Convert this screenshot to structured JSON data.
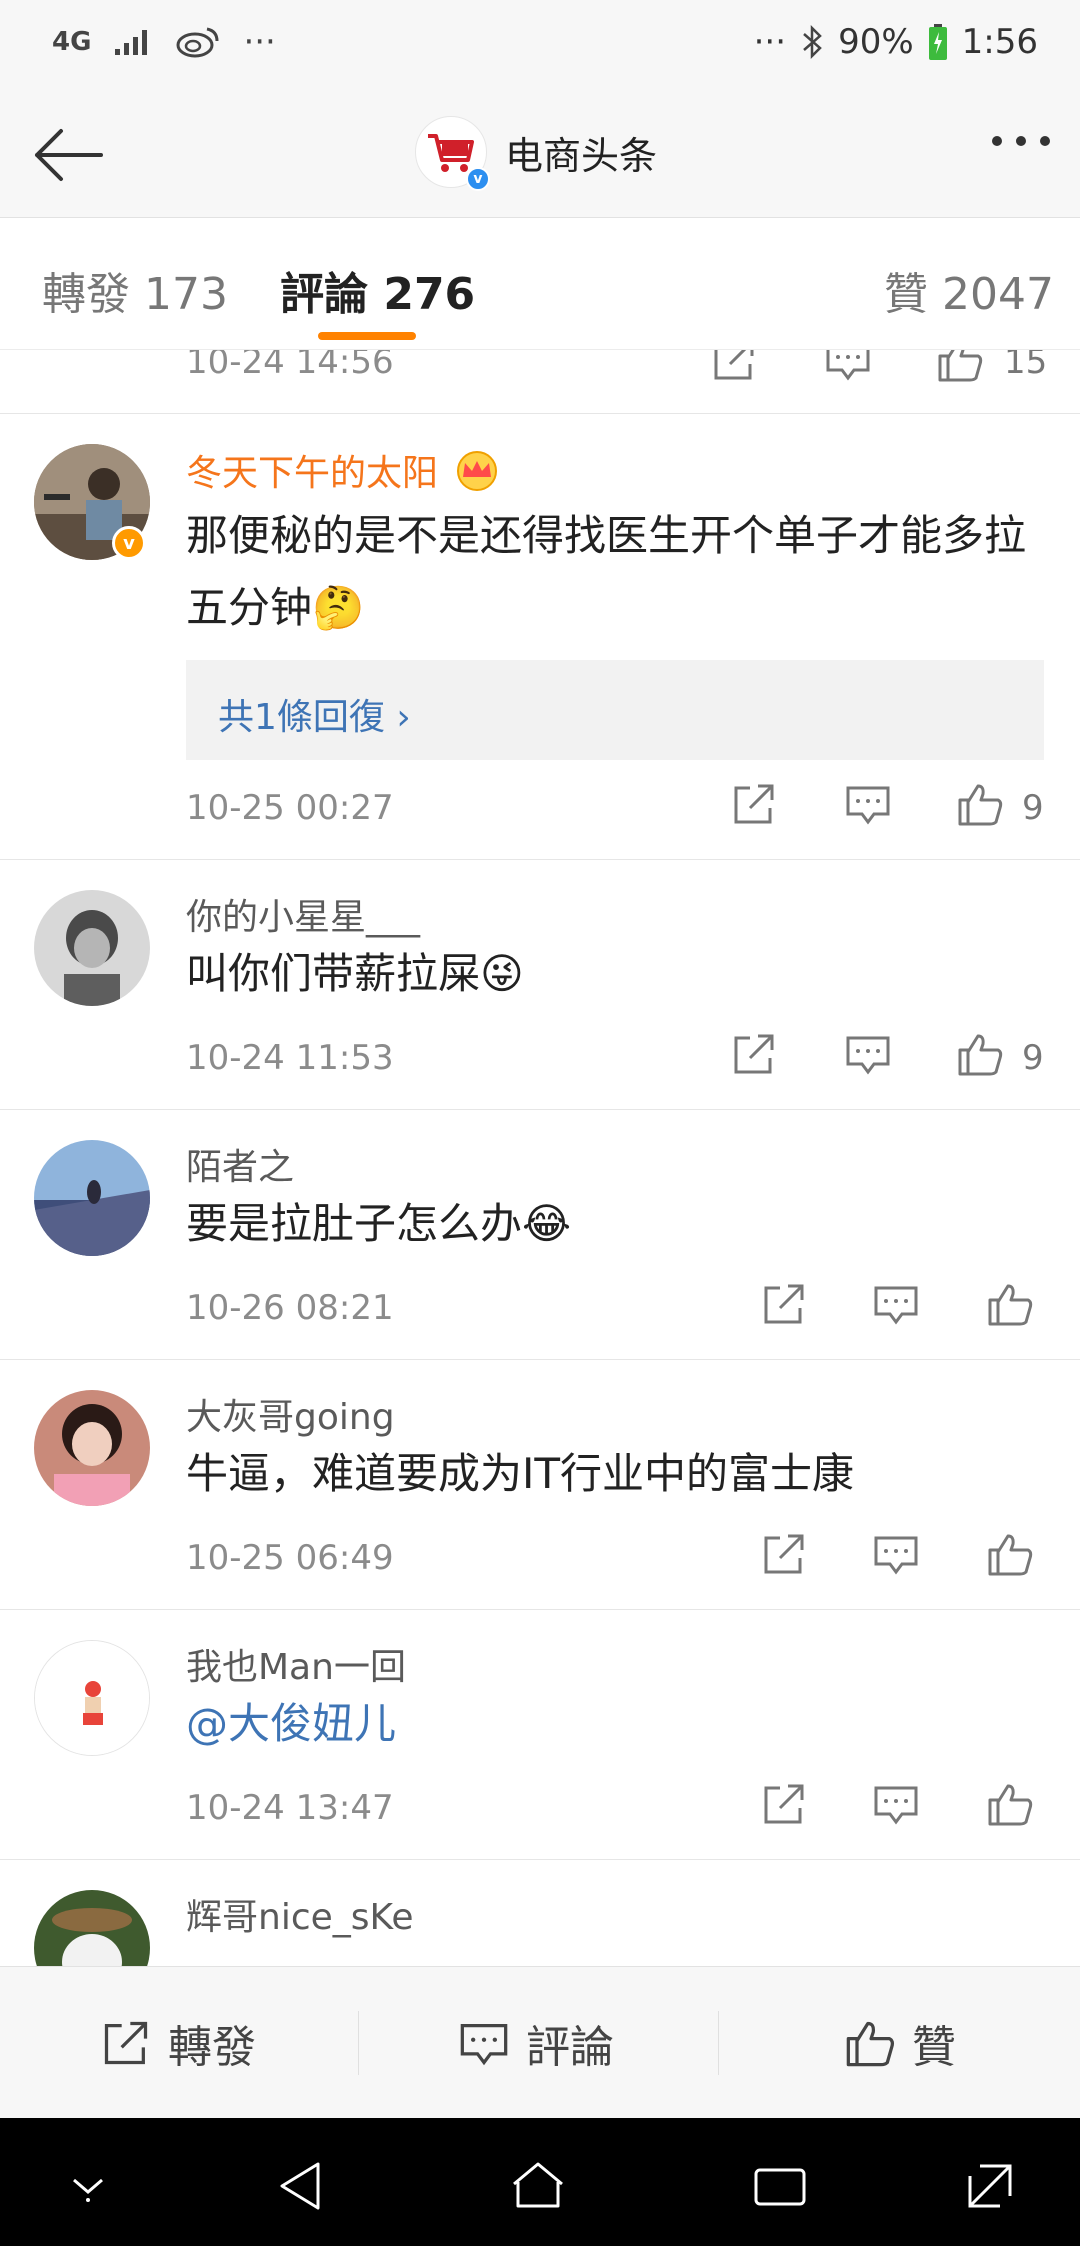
{
  "status_bar": {
    "network": "4G",
    "overflow": "···",
    "right_overflow": "···",
    "battery": "90%",
    "time": "1:56"
  },
  "nav": {
    "title": "电商头条"
  },
  "tabs": [
    {
      "label": "轉發",
      "count": "173"
    },
    {
      "label": "評論",
      "count": "276"
    },
    {
      "label": "贊",
      "count": "2047"
    }
  ],
  "top_partial": {
    "time": "10-24 14:56",
    "likes": "15"
  },
  "comments": [
    {
      "user": "冬天下午的太阳",
      "text": "那便秘的是不是还得找医生开个单子才能多拉五分钟",
      "emoji": "🤔",
      "reply_summary": "共1條回復 ›",
      "time": "10-25 00:27",
      "likes": "9"
    },
    {
      "user": "你的小星星___",
      "text": "叫你们带薪拉屎",
      "emoji": "😜",
      "time": "10-24 11:53",
      "likes": "9"
    },
    {
      "user": "陌者之",
      "text": "要是拉肚子怎么办",
      "emoji": "😂",
      "time": "10-26 08:21",
      "likes": ""
    },
    {
      "user": "大灰哥going",
      "text": "牛逼，难道要成为IT行业中的富士康",
      "time": "10-25 06:49",
      "likes": ""
    },
    {
      "user": "我也Man一回",
      "text": "@大俊妞儿",
      "time": "10-24 13:47",
      "likes": ""
    },
    {
      "user": "辉哥nice_sKe",
      "text": "",
      "time": "",
      "likes": ""
    }
  ],
  "bottom_bar": {
    "repost": "轉發",
    "comment": "評論",
    "like": "贊"
  },
  "colors": {
    "accent": "#ff8200",
    "vip_name": "#f5751b",
    "link": "#3e74b5"
  }
}
